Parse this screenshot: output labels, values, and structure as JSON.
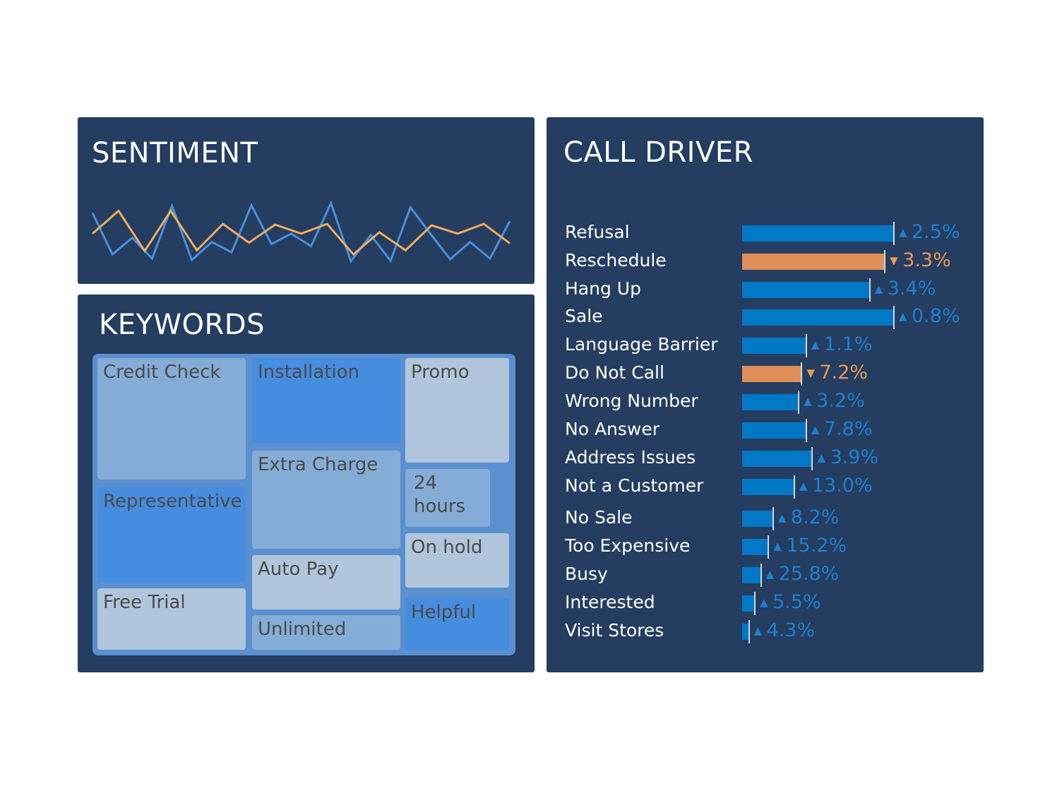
{
  "colors": {
    "panel_bg": "#243d60",
    "blue_line": "#4a8fdc",
    "orange_line": "#f0ad5e",
    "bar_up": "#0078c6",
    "bar_down": "#de8f57",
    "text_up": "#1e7fd0",
    "text_down": "#e89a55",
    "tile_dark": "#468ddf",
    "tile_mid": "#84acd6",
    "tile_light": "#b1c6dc"
  },
  "sentiment": {
    "title": "SENTIMENT"
  },
  "keywords": {
    "title": "KEYWORDS"
  },
  "calldriver": {
    "title": "CALL DRIVER"
  },
  "chart_data": [
    {
      "type": "line",
      "title": "SENTIMENT",
      "xlabel": "",
      "ylabel": "",
      "grid": false,
      "legend": "none",
      "ylim": [
        0,
        100
      ],
      "series": [
        {
          "name": "blue",
          "color": "#4a8fdc",
          "values": [
            72,
            12,
            36,
            6,
            82,
            4,
            30,
            15,
            83,
            27,
            42,
            24,
            86,
            2,
            40,
            3,
            80,
            42,
            5,
            30,
            6,
            60
          ]
        },
        {
          "name": "orange",
          "color": "#f0ad5e",
          "values": [
            42,
            75,
            17,
            75,
            18,
            56,
            29,
            55,
            42,
            56,
            12,
            44,
            18,
            54,
            42,
            56,
            28
          ]
        }
      ]
    },
    {
      "type": "heatmap",
      "subtype": "treemap",
      "title": "KEYWORDS",
      "tiles": [
        {
          "label": "Credit Check",
          "shade": "mid"
        },
        {
          "label": "Representative",
          "shade": "dark"
        },
        {
          "label": "Free Trial",
          "shade": "light"
        },
        {
          "label": "Installation",
          "shade": "dark"
        },
        {
          "label": "Extra Charge",
          "shade": "mid"
        },
        {
          "label": "Auto Pay",
          "shade": "light"
        },
        {
          "label": "Unlimited",
          "shade": "mid"
        },
        {
          "label": "Promo",
          "shade": "light"
        },
        {
          "label": "24 hours",
          "shade": "mid"
        },
        {
          "label": "On hold",
          "shade": "light"
        },
        {
          "label": "Helpful",
          "shade": "dark"
        }
      ]
    },
    {
      "type": "bar",
      "orientation": "horizontal",
      "title": "CALL DRIVER",
      "xlim": [
        0,
        100
      ],
      "categories": [
        "Refusal",
        "Reschedule",
        "Hang Up",
        "Sale",
        "Language Barrier",
        "Do Not Call",
        "Wrong Number",
        "No Answer",
        "Address Issues",
        "Not a Customer",
        "No Sale",
        "Too Expensive",
        "Busy",
        "Interested",
        "Visit Stores"
      ],
      "values": [
        100,
        94,
        84,
        100,
        42,
        39,
        37,
        42,
        46,
        34,
        20,
        17,
        12,
        8,
        4
      ],
      "changes": [
        "2.5%",
        "3.3%",
        "3.4%",
        "0.8%",
        "1.1%",
        "7.2%",
        "3.2%",
        "7.8%",
        "3.9%",
        "13.0%",
        "8.2%",
        "15.2%",
        "25.8%",
        "5.5%",
        "4.3%"
      ],
      "directions": [
        "up",
        "down",
        "up",
        "up",
        "up",
        "down",
        "up",
        "up",
        "up",
        "up",
        "up",
        "up",
        "up",
        "up",
        "up"
      ]
    }
  ]
}
